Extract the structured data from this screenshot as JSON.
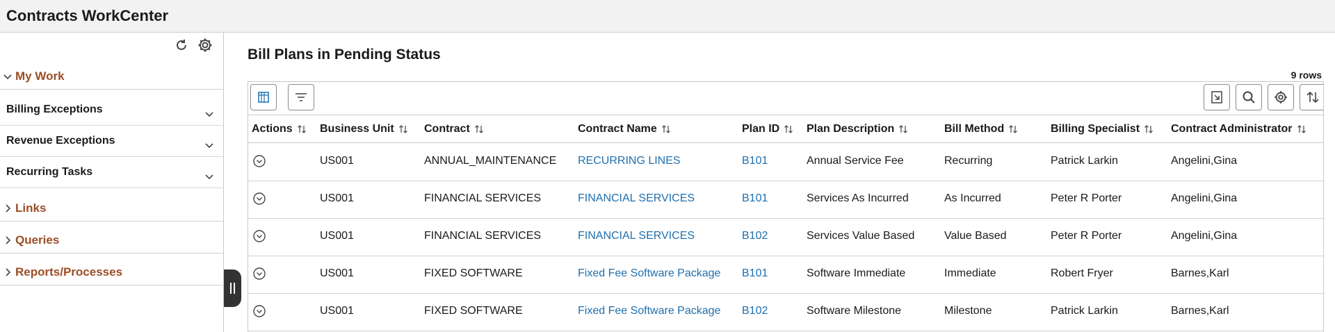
{
  "app": {
    "title": "Contracts WorkCenter"
  },
  "sidebar": {
    "tools": {
      "refresh_icon": "refresh-icon",
      "settings_icon": "gear-icon"
    },
    "my_work": {
      "label": "My Work",
      "items": [
        {
          "label": "Billing Exceptions"
        },
        {
          "label": "Revenue Exceptions"
        },
        {
          "label": "Recurring Tasks"
        }
      ]
    },
    "links": {
      "label": "Links"
    },
    "queries": {
      "label": "Queries"
    },
    "reports": {
      "label": "Reports/Processes"
    }
  },
  "grid": {
    "title": "Bill Plans in Pending Status",
    "row_count": "9 rows",
    "columns": [
      "Actions",
      "Business Unit",
      "Contract",
      "Contract Name",
      "Plan ID",
      "Plan Description",
      "Bill Method",
      "Billing Specialist",
      "Contract Administrator"
    ],
    "rows": [
      {
        "business_unit": "US001",
        "contract": "ANNUAL_MAINTENANCE",
        "contract_name": "RECURRING LINES",
        "plan_id": "B101",
        "plan_description": "Annual Service Fee",
        "bill_method": "Recurring",
        "billing_specialist": "Patrick Larkin",
        "contract_admin": "Angelini,Gina"
      },
      {
        "business_unit": "US001",
        "contract": "FINANCIAL SERVICES",
        "contract_name": "FINANCIAL SERVICES",
        "plan_id": "B101",
        "plan_description": "Services As Incurred",
        "bill_method": "As Incurred",
        "billing_specialist": "Peter R Porter",
        "contract_admin": "Angelini,Gina"
      },
      {
        "business_unit": "US001",
        "contract": "FINANCIAL SERVICES",
        "contract_name": "FINANCIAL SERVICES",
        "plan_id": "B102",
        "plan_description": "Services Value Based",
        "bill_method": "Value Based",
        "billing_specialist": "Peter R Porter",
        "contract_admin": "Angelini,Gina"
      },
      {
        "business_unit": "US001",
        "contract": "FIXED SOFTWARE",
        "contract_name": "Fixed Fee Software Package",
        "plan_id": "B101",
        "plan_description": "Software Immediate",
        "bill_method": "Immediate",
        "billing_specialist": "Robert Fryer",
        "contract_admin": "Barnes,Karl"
      },
      {
        "business_unit": "US001",
        "contract": "FIXED SOFTWARE",
        "contract_name": "Fixed Fee Software Package",
        "plan_id": "B102",
        "plan_description": "Software Milestone",
        "bill_method": "Milestone",
        "billing_specialist": "Patrick Larkin",
        "contract_admin": "Barnes,Karl"
      }
    ]
  },
  "colors": {
    "accent": "#9b4d26",
    "link": "#1f6fad"
  }
}
